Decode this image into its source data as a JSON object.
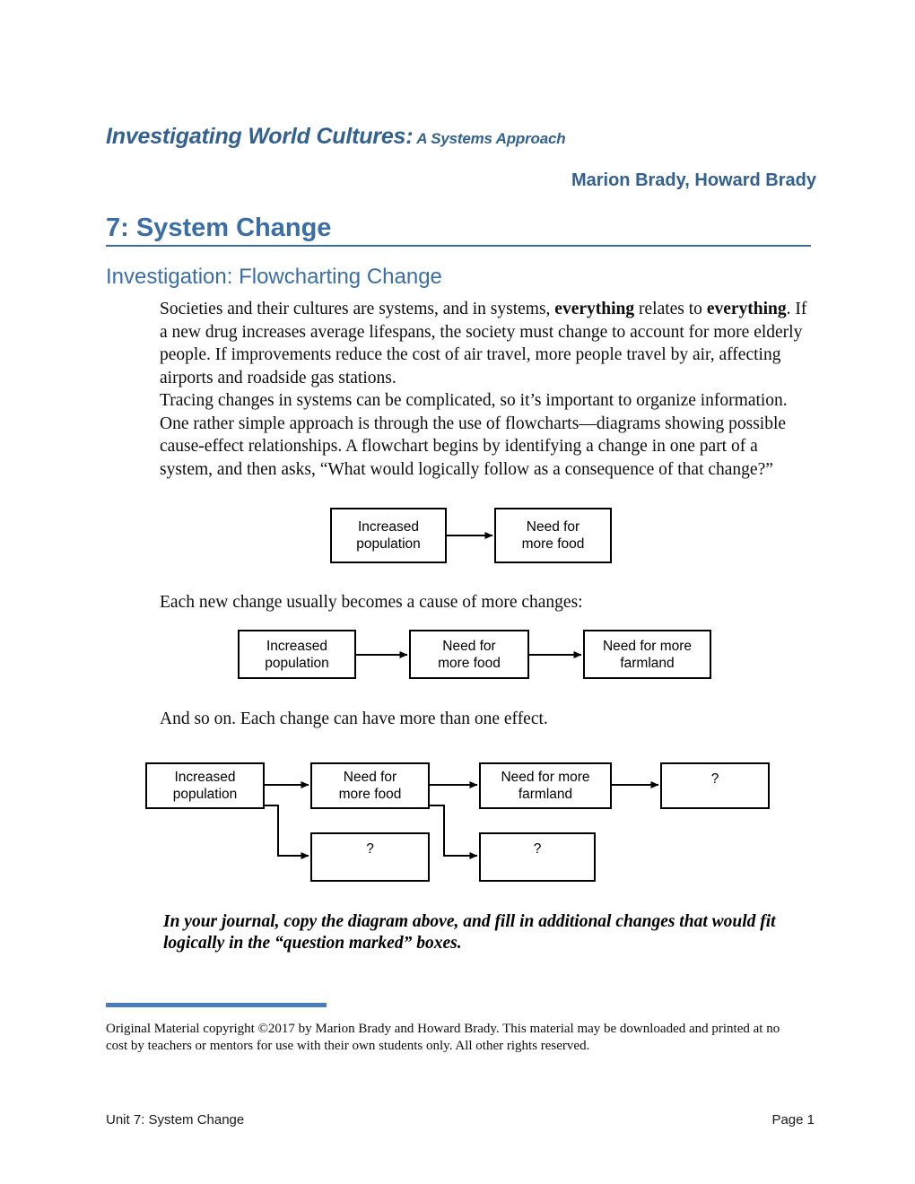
{
  "document": {
    "title_main": "Investigating World Cultures:",
    "title_sub": " A Systems Approach",
    "byline": "Marion Brady, Howard Brady",
    "unit_heading": "7: System Change",
    "section_heading": "Investigation: Flowcharting Change",
    "accent_color": "#3a6ea5",
    "footnote_rule_color": "#4a7ebb"
  },
  "body": {
    "paragraph_1_part_1": "Societies and their cultures are systems, and in systems, ",
    "paragraph_1_bold_1": "everything",
    "paragraph_1_part_2": " relates to ",
    "paragraph_1_bold_2": "everything",
    "paragraph_1_part_3": ". If a new drug increases average lifespans, the society must change to account for more elderly people. If improvements reduce the cost of air travel, more people travel by air, affecting airports and roadside gas stations.",
    "paragraph_2": "Tracing changes in systems can be complicated, so it’s important to organize information. One rather simple approach is through the use of flowcharts—diagrams showing possible cause-effect relationships. A flowchart begins by identifying a change in one part of a system, and then asks, “What would logically follow as a consequence of that change?”",
    "paragraph_3": "Each new change usually becomes a cause of more changes:",
    "paragraph_4": "And so on.  Each change can have more than one effect.",
    "instruction": "In your journal, copy the diagram above, and fill in additional changes that would fit logically in the “question marked” boxes."
  },
  "diagrams": {
    "diagram_1": {
      "boxes": [
        {
          "label": "Increased\npopulation"
        },
        {
          "label": "Need for\nmore food"
        }
      ]
    },
    "diagram_2": {
      "boxes": [
        {
          "label": "Increased\npopulation"
        },
        {
          "label": "Need for\nmore food"
        },
        {
          "label": "Need for more\nfarmland"
        }
      ]
    },
    "diagram_3": {
      "top_boxes": [
        {
          "label": "Increased\npopulation"
        },
        {
          "label": "Need for\nmore food"
        },
        {
          "label": "Need for more\nfarmland"
        },
        {
          "label": "?"
        }
      ],
      "bottom_boxes": [
        {
          "label": "?"
        },
        {
          "label": "?"
        }
      ]
    }
  },
  "footer": {
    "copyright": "Original Material copyright ©2017 by Marion Brady and Howard Brady. This material may be downloaded and printed at no cost by teachers or mentors for use with their own students only. All other rights reserved.",
    "unit_label": "Unit 7: System Change",
    "page_label": "Page 1"
  }
}
